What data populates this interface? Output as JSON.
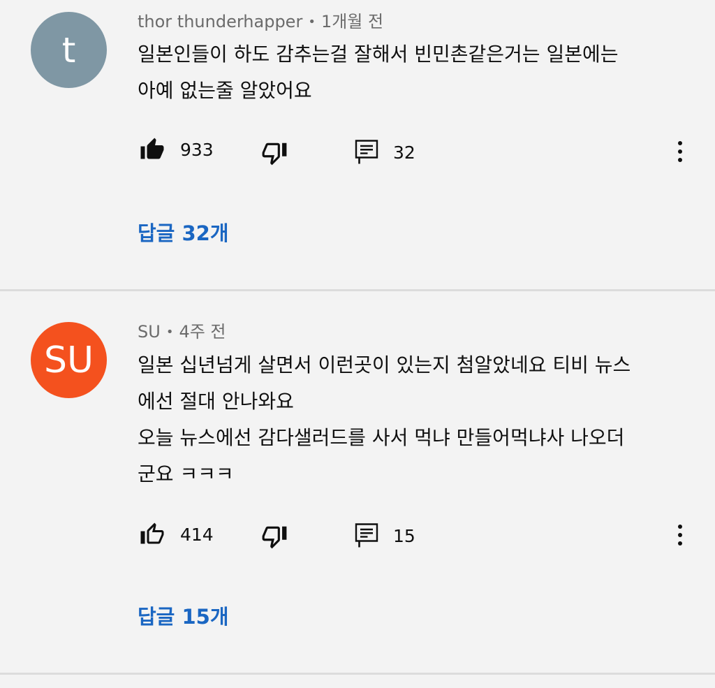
{
  "comments": [
    {
      "avatar_letter": "t",
      "avatar_color": "#7f97a4",
      "author": "thor thunderhapper",
      "separator": "•",
      "time": "1개월 전",
      "lines": [
        "일본인들이 하도 감추는걸 잘해서 빈민촌같은거는 일본에는",
        "아예 없는줄 알았어요"
      ],
      "like_icon": "thumbs-up-filled-icon",
      "likes": "933",
      "dislike_icon": "thumbs-down-icon",
      "reply_icon": "comment-icon",
      "reply_count": "32",
      "replies_label": "답글 32개"
    },
    {
      "avatar_letter": "SU",
      "avatar_color": "#f4511e",
      "author": "SU",
      "separator": "•",
      "time": "4주 전",
      "lines": [
        "일본 십년넘게 살면서 이런곳이 있는지 첨알았네요 티비 뉴스",
        "에선 절대 안나와요",
        "오늘 뉴스에선 감다샐러드를 사서 먹냐 만들어먹냐사 나오더",
        "군요 ㅋㅋㅋ"
      ],
      "like_icon": "thumbs-up-outline-icon",
      "likes": "414",
      "dislike_icon": "thumbs-down-icon",
      "reply_icon": "comment-icon",
      "reply_count": "15",
      "replies_label": "답글 15개"
    }
  ],
  "colors": {
    "background": "#f3f3f3",
    "reply_link": "#1a66c2",
    "meta_text": "#6b6b6b"
  }
}
